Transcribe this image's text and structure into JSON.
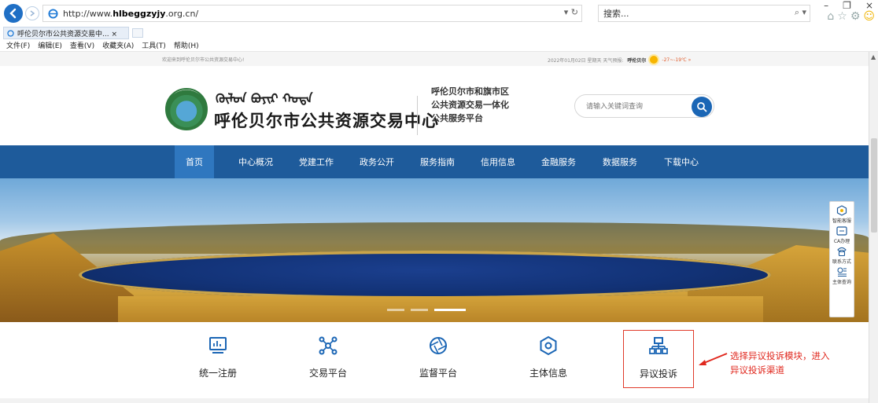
{
  "browser": {
    "url_prefix": "http://www.",
    "url_bold": "hlbeggzyjy",
    "url_suffix": ".org.cn/",
    "addr_tools": "▾ ↻",
    "search_placeholder": "搜索...",
    "search_tools": "⌕ ▾",
    "tab_title": "呼伦贝尔市公共资源交易中... ×",
    "window_buttons": [
      "–",
      "❐",
      "×"
    ],
    "menu": [
      "文件(F)",
      "编辑(E)",
      "查看(V)",
      "收藏夹(A)",
      "工具(T)",
      "帮助(H)"
    ]
  },
  "topstrip": {
    "welcome": "欢迎来到呼伦贝尔市公共资源交易中心!",
    "date": "2022年01月02日 星期天  天气预报:",
    "city": "呼伦贝尔",
    "temp": "-27~-19℃ »"
  },
  "header": {
    "mongolian": "ᠬᠥᠯᠦᠨ ᠪᠤᠶᠢᠷ ᠬᠣᠲᠠ",
    "site_name": "呼伦贝尔市公共资源交易中心",
    "subtitle_line1": "呼伦贝尔市和旗市区",
    "subtitle_line2": "公共资源交易一体化",
    "subtitle_line3": "公共服务平台",
    "search_placeholder": "请输入关键词查询"
  },
  "nav": [
    "首页",
    "中心概况",
    "党建工作",
    "政务公开",
    "服务指南",
    "信用信息",
    "金融服务",
    "数据服务",
    "下载中心"
  ],
  "floatbar": [
    "智能客服",
    "CA办理",
    "联系方式",
    "主体查询"
  ],
  "modules": [
    "统一注册",
    "交易平台",
    "监督平台",
    "主体信息",
    "异议投诉"
  ],
  "annotation": {
    "line1": "选择异议投诉模块，进入",
    "line2": "异议投诉渠道"
  },
  "colors": {
    "nav_bg": "#1e5b9b",
    "accent": "#1b66b5",
    "annotation": "#e0281e"
  }
}
